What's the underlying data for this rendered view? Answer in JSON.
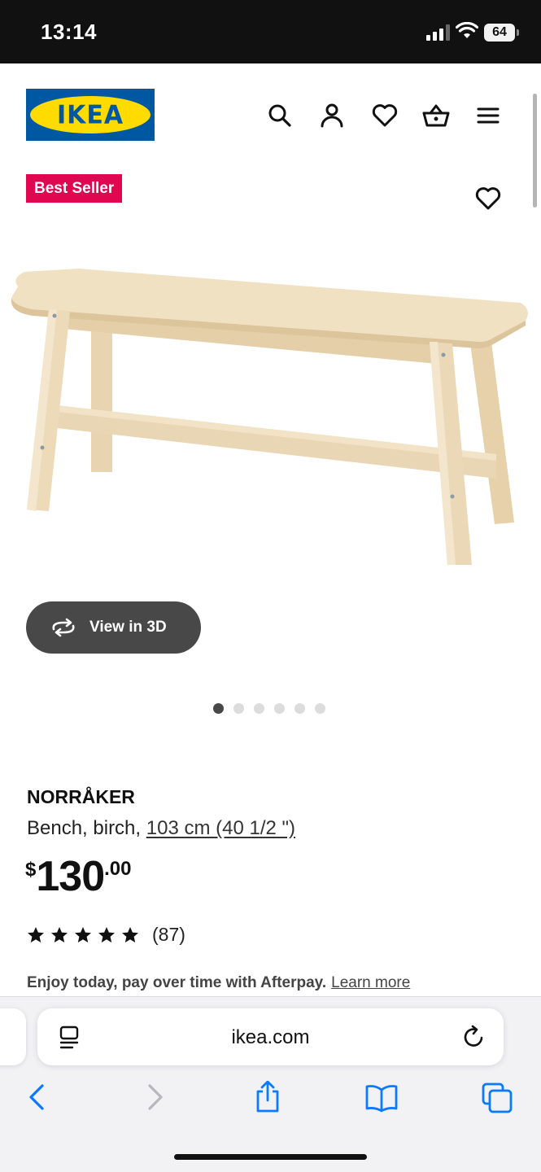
{
  "status_bar": {
    "time": "13:14",
    "battery": "64"
  },
  "header": {
    "logo_text": "IKEA",
    "icons": [
      "search-icon",
      "account-icon",
      "heart-icon",
      "basket-icon",
      "menu-icon"
    ]
  },
  "badge": "Best Seller",
  "image": {
    "alt": "NORRÅKER bench, birch",
    "wood_color": "#ecd9b8"
  },
  "view_3d_label": "View in 3D",
  "carousel": {
    "total": 6,
    "active": 1
  },
  "product": {
    "name": "NORRÅKER",
    "description": "Bench, birch, ",
    "size": "103 cm (40 1/2 \")",
    "price": {
      "currency": "$",
      "integer": "130",
      "decimal": ".00"
    },
    "rating": {
      "stars": 5,
      "count": "(87)"
    },
    "afterpay_text": "Enjoy today, pay over time with Afterpay.",
    "afterpay_link": "Learn more"
  },
  "browser": {
    "url": "ikea.com",
    "toolbar": [
      "back-icon",
      "forward-icon",
      "share-icon",
      "bookmarks-icon",
      "tabs-icon"
    ],
    "accent": "#0a7aff"
  },
  "colors": {
    "ikea_blue": "#0058a3",
    "ikea_yellow": "#ffdb00",
    "badge_red": "#e00751"
  }
}
